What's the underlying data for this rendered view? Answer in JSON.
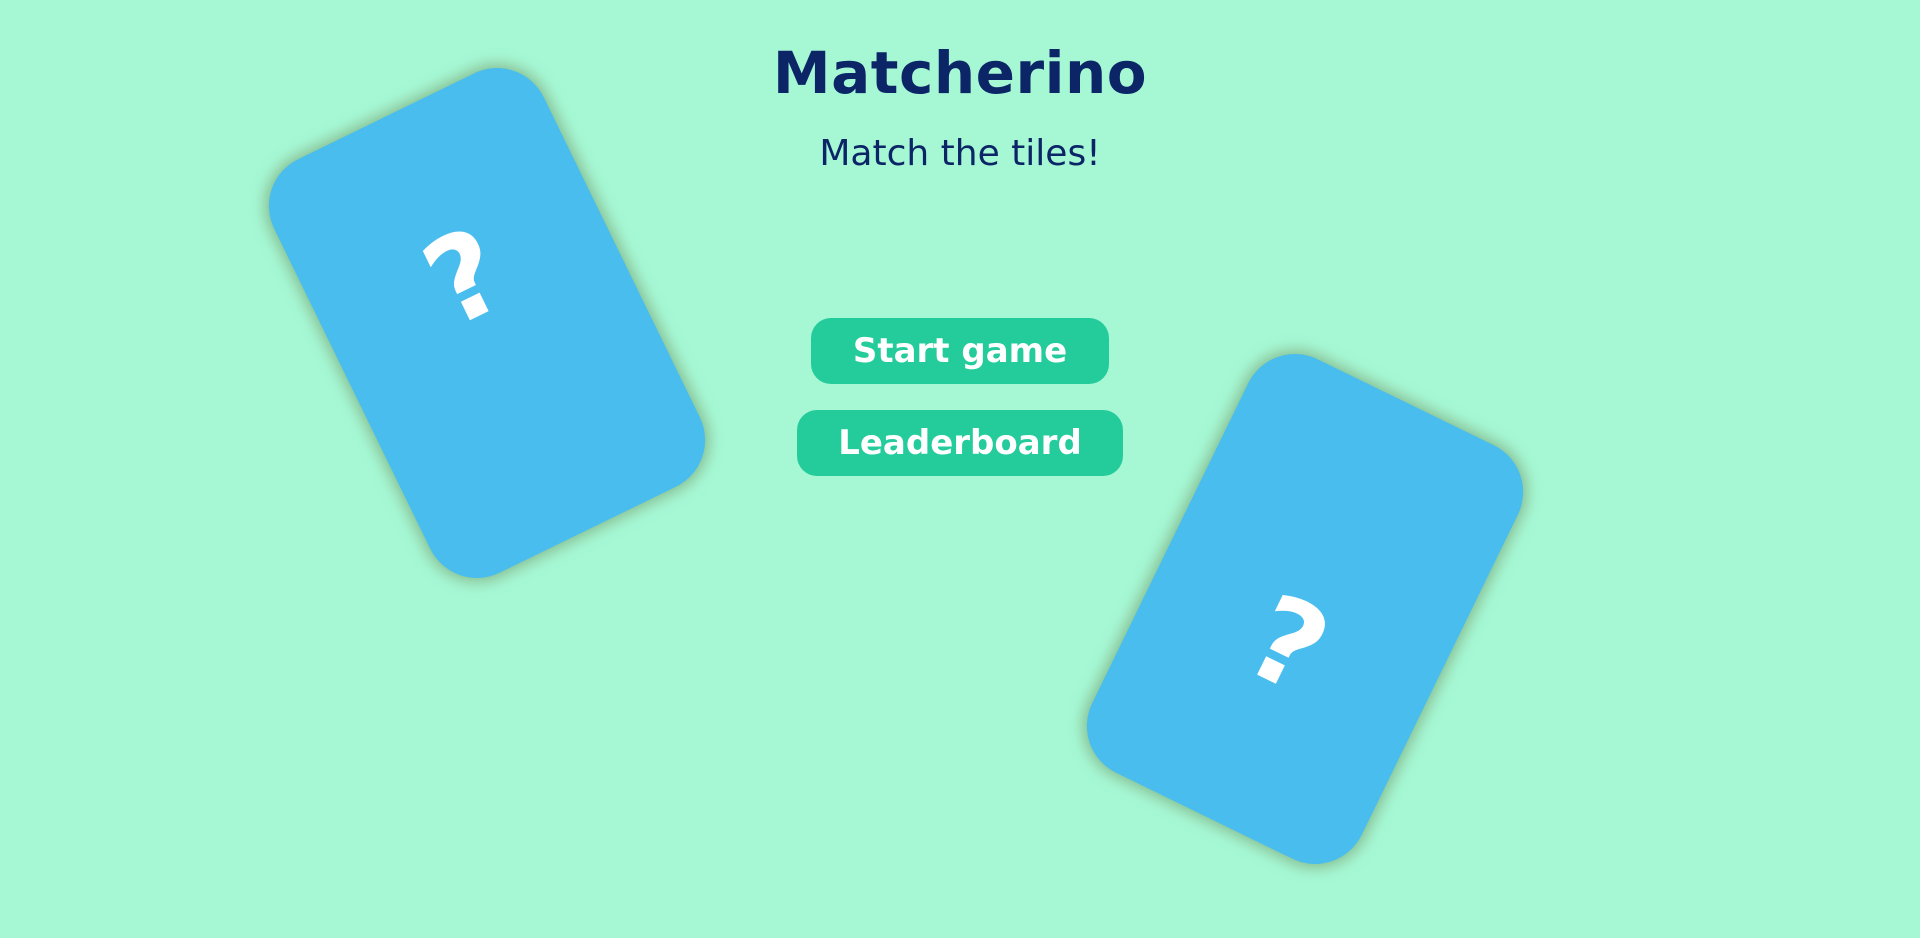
{
  "game": {
    "title": "Matcherino",
    "subtitle": "Match the tiles!"
  },
  "menu": {
    "start_label": "Start game",
    "leaderboard_label": "Leaderboard"
  },
  "cards": [
    {
      "face": "?",
      "state": "face-down",
      "icon": "question-mark-icon"
    },
    {
      "face": "?",
      "state": "face-down",
      "icon": "question-mark-icon"
    }
  ],
  "colors": {
    "background": "#a6f8d5",
    "title_text": "#0b2566",
    "button": "#24cc9c",
    "card": "#48bdee",
    "card_symbol": "#ffffff"
  }
}
